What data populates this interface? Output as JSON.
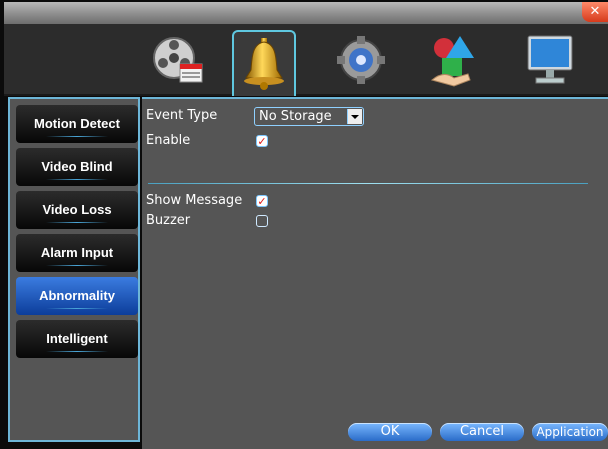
{
  "window": {
    "close_glyph": "✕"
  },
  "toolbar": {
    "icons": [
      {
        "name": "record-icon",
        "active": false
      },
      {
        "name": "alarm-bell-icon",
        "active": true
      },
      {
        "name": "system-gear-icon",
        "active": false
      },
      {
        "name": "advanced-icon",
        "active": false
      },
      {
        "name": "monitor-icon",
        "active": false
      }
    ]
  },
  "sidebar": {
    "items": [
      {
        "label": "Motion Detect",
        "active": false
      },
      {
        "label": "Video Blind",
        "active": false
      },
      {
        "label": "Video Loss",
        "active": false
      },
      {
        "label": "Alarm Input",
        "active": false
      },
      {
        "label": "Abnormality",
        "active": true
      },
      {
        "label": "Intelligent",
        "active": false
      }
    ]
  },
  "form": {
    "event_type_label": "Event Type",
    "event_type_value": "No Storage",
    "enable_label": "Enable",
    "enable_checked": true,
    "show_message_label": "Show Message",
    "show_message_checked": true,
    "buzzer_label": "Buzzer",
    "buzzer_checked": false,
    "check_glyph": "✓"
  },
  "buttons": {
    "ok": "OK",
    "cancel": "Cancel",
    "apply": "Application"
  },
  "colors": {
    "accent": "#6db6d8",
    "active_item": "#1f5ec0",
    "panel_bg": "#555555"
  }
}
